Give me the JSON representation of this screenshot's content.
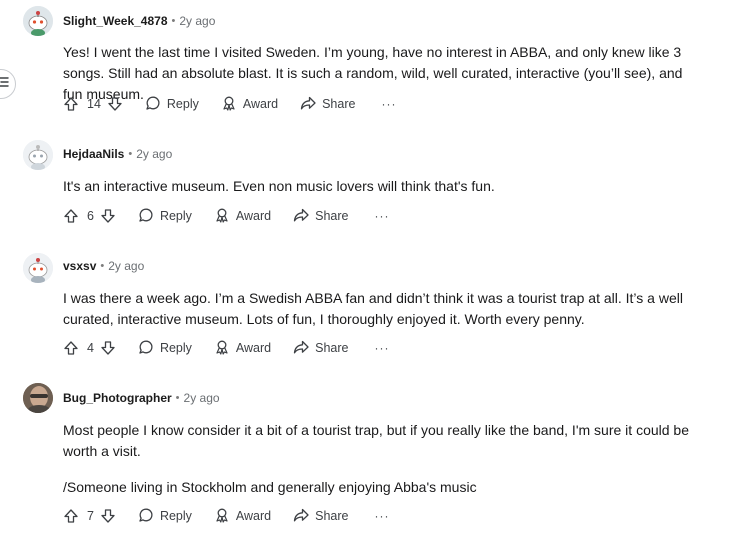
{
  "comments": [
    {
      "username": "Slight_Week_4878",
      "time": "2y ago",
      "paragraphs": [
        "Yes! I went the last time I visited Sweden. I’m young, have no interest in ABBA, and only knew like 3 songs. Still had an absolute blast. It is such a random, wild, well curated, interactive (you’ll see), and fun museum."
      ],
      "votes": "14",
      "reply": "Reply",
      "award": "Award",
      "share": "Share",
      "more": "···"
    },
    {
      "username": "HejdaaNils",
      "time": "2y ago",
      "paragraphs": [
        "It's an interactive museum. Even non music lovers will think that's fun."
      ],
      "votes": "6",
      "reply": "Reply",
      "award": "Award",
      "share": "Share",
      "more": "···"
    },
    {
      "username": "vsxsv",
      "time": "2y ago",
      "paragraphs": [
        "I was there a week ago. I’m a Swedish ABBA fan and didn’t think it was a tourist trap at all. It’s a well curated, interactive museum. Lots of fun, I thoroughly enjoyed it. Worth every penny."
      ],
      "votes": "4",
      "reply": "Reply",
      "award": "Award",
      "share": "Share",
      "more": "···"
    },
    {
      "username": "Bug_Photographer",
      "time": "2y ago",
      "paragraphs": [
        "Most people I know consider it a bit of a tourist trap, but if you really like the band, I'm sure it could be worth a visit.",
        "/Someone living in Stockholm and generally enjoying Abba's music"
      ],
      "votes": "7",
      "reply": "Reply",
      "award": "Award",
      "share": "Share",
      "more": "···"
    }
  ],
  "meta_separator": "•",
  "icons": {
    "upvote": "upvote-arrow-icon",
    "downvote": "downvote-arrow-icon",
    "reply": "speech-bubble-icon",
    "award": "award-ribbon-icon",
    "share": "share-arrow-icon",
    "sidebar": "list-menu-icon"
  },
  "colors": {
    "text": "#1a1a1b",
    "meta": "#6b6f73",
    "action": "#3d4044",
    "background": "#ffffff"
  }
}
